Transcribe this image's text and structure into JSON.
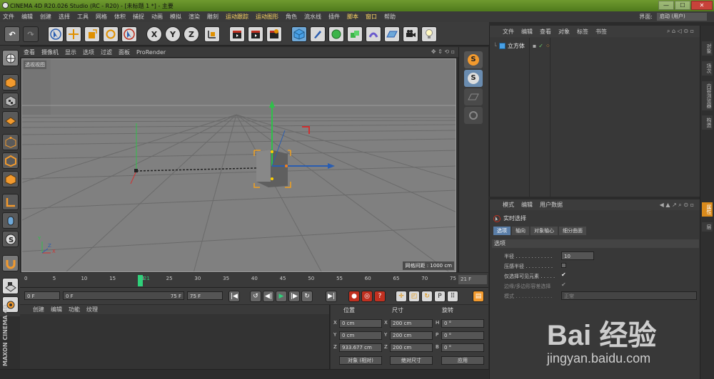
{
  "window": {
    "title": "CINEMA 4D R20.026 Studio (RC - R20) - [未标题 1 *] - 主要",
    "min": "—",
    "max": "☐",
    "close": "✕"
  },
  "menubar": {
    "items": [
      "文件",
      "编辑",
      "创建",
      "选择",
      "工具",
      "网格",
      "体积",
      "捕捉",
      "动画",
      "模拟",
      "渲染",
      "雕刻",
      "运动跟踪",
      "运动图形",
      "角色",
      "流水线",
      "插件",
      "脚本",
      "窗口",
      "帮助"
    ],
    "layout_label": "界面:",
    "layout_value": "启动 (用户)"
  },
  "toolbar": {
    "undo_icon": "↶",
    "redo_icon": "↷",
    "x_label": "X",
    "y_label": "Y",
    "z_label": "Z"
  },
  "viewport": {
    "menu": [
      "查看",
      "摄像机",
      "显示",
      "选项",
      "过滤",
      "面板",
      "ProRender"
    ],
    "label": "透视视图",
    "grid_info": "网格间距 : 1000 cm",
    "axis_x": "X",
    "axis_y": "Y",
    "axis_z": "Z"
  },
  "timeline": {
    "ticks": [
      "0",
      "5",
      "10",
      "15",
      "20",
      "21",
      "25",
      "30",
      "35",
      "40",
      "45",
      "50",
      "55",
      "60",
      "65",
      "70",
      "75"
    ],
    "current_frame": 21,
    "end_field": "21 F"
  },
  "transport": {
    "start_field": "0 F",
    "range_start": "0 F",
    "range_end": "75 F",
    "end_field": "75 F"
  },
  "materials": {
    "menu": [
      "创建",
      "编辑",
      "功能",
      "纹理"
    ]
  },
  "brand": {
    "text": "MAXON CINEMA 4D"
  },
  "coordinates": {
    "headers": [
      "位置",
      "尺寸",
      "旋转"
    ],
    "rows": [
      {
        "pos_axis": "X",
        "pos": "0 cm",
        "size_axis": "X",
        "size": "200 cm",
        "rot_axis": "H",
        "rot": "0 °"
      },
      {
        "pos_axis": "Y",
        "pos": "0 cm",
        "size_axis": "Y",
        "size": "200 cm",
        "rot_axis": "P",
        "rot": "0 °"
      },
      {
        "pos_axis": "Z",
        "pos": "933.677 cm",
        "size_axis": "Z",
        "size": "200 cm",
        "rot_axis": "B",
        "rot": "0 °"
      }
    ],
    "mode_object": "对象 (相对)",
    "mode_size": "绝对尺寸",
    "apply": "应用"
  },
  "object_manager": {
    "menu": [
      "文件",
      "编辑",
      "查看",
      "对象",
      "标签",
      "书签"
    ],
    "objects": [
      {
        "name": "立方体"
      }
    ]
  },
  "attribute_manager": {
    "menu": [
      "模式",
      "编辑",
      "用户数据"
    ],
    "tool_name": "实时选择",
    "tabs": [
      "选项",
      "轴向",
      "对象轴心",
      "细分曲面"
    ],
    "section": "选项",
    "props": [
      {
        "label": "半径 . . . . . . . . . . . .",
        "value": "10"
      },
      {
        "label": "压感半径 . . . . . . . . .",
        "value": ""
      },
      {
        "label": "仅选择可见元素 . . . . .",
        "value": "✔"
      },
      {
        "label": "边缘/多边形容差选择",
        "value": "✔"
      },
      {
        "label": "模式 . . . . . . . . . . . .",
        "value": "正常"
      }
    ]
  },
  "right_tabs": [
    "对象",
    "场次",
    "内容浏览器",
    "构造",
    "属性",
    "层"
  ],
  "watermark": {
    "word": "Bai 经验",
    "url": "jingyan.baidu.com"
  },
  "colors": {
    "accent": "#f29a2e",
    "title_green": "#5f8a24",
    "selection_blue": "#5a7ea8"
  }
}
